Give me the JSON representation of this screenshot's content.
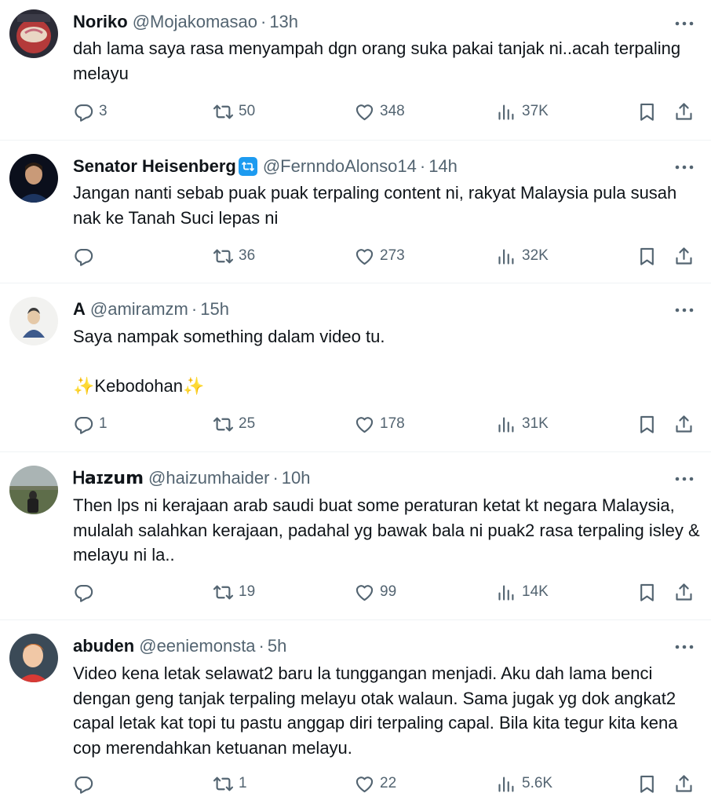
{
  "colors": {
    "text": "#0f1419",
    "muted": "#536471",
    "divider": "#eff3f4",
    "verified": "#1d9bf0"
  },
  "tweets": [
    {
      "name": "Noriko",
      "handle": "@Mojakomasao",
      "sep": "·",
      "time": "13h",
      "text": "dah lama saya rasa menyampah dgn orang suka pakai tanjak ni..acah terpaling melayu",
      "replies": "3",
      "retweets": "50",
      "likes": "348",
      "views": "37K"
    },
    {
      "name": "Senator Heisenberg",
      "verified_icon": "retweet-badge-icon",
      "handle": "@FernndoAlonso14",
      "sep": "·",
      "time": "14h",
      "text": "Jangan nanti sebab puak puak terpaling content ni, rakyat Malaysia pula susah nak ke Tanah Suci lepas ni",
      "replies": "",
      "retweets": "36",
      "likes": "273",
      "views": "32K"
    },
    {
      "name": "A",
      "handle": "@amiramzm",
      "sep": "·",
      "time": "15h",
      "text": "Saya nampak something dalam video tu.\n\n✨Kebodohan✨",
      "replies": "1",
      "retweets": "25",
      "likes": "178",
      "views": "31K"
    },
    {
      "name": "Ꮋ𝗮ɪ𝘇𝘂𝗺",
      "handle": "@haizumhaider",
      "sep": "·",
      "time": "10h",
      "text": "Then lps ni kerajaan arab saudi buat some peraturan ketat kt negara Malaysia, mulalah salahkan kerajaan, padahal yg bawak bala ni puak2 rasa terpaling isley & melayu ni la..",
      "replies": "",
      "retweets": "19",
      "likes": "99",
      "views": "14K"
    },
    {
      "name": "abuden",
      "handle": "@eeniemonsta",
      "sep": "·",
      "time": "5h",
      "text": "Video kena letak selawat2 baru la tunggangan menjadi. Aku dah lama benci dengan geng tanjak terpaling melayu otak walaun. Sama jugak yg dok angkat2 capal letak kat topi tu pastu anggap diri terpaling capal. Bila kita tegur kita kena cop merendahkan ketuanan melayu.",
      "replies": "",
      "retweets": "1",
      "likes": "22",
      "views": "5.6K"
    }
  ]
}
